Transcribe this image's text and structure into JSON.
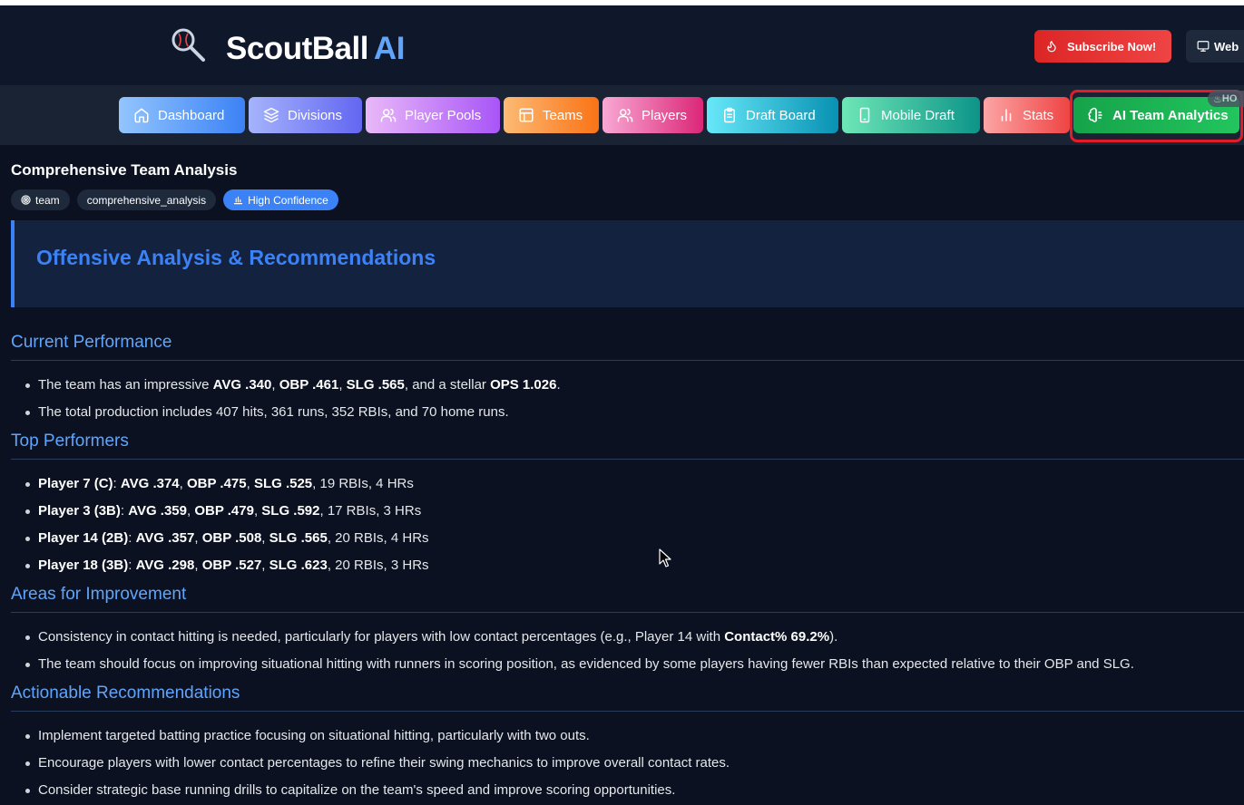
{
  "header": {
    "brand_name": "ScoutBall",
    "brand_ai": "AI",
    "subscribe_label": "Subscribe Now!",
    "web_label": "Web"
  },
  "nav": {
    "items": [
      {
        "label": "Dashboard",
        "icon": "home-icon"
      },
      {
        "label": "Divisions",
        "icon": "layers-icon"
      },
      {
        "label": "Player Pools",
        "icon": "users-icon"
      },
      {
        "label": "Teams",
        "icon": "table-icon"
      },
      {
        "label": "Players",
        "icon": "users-icon"
      },
      {
        "label": "Draft Board",
        "icon": "clipboard-icon"
      },
      {
        "label": "Mobile Draft",
        "icon": "smartphone-icon"
      },
      {
        "label": "Stats",
        "icon": "bar-chart-icon"
      },
      {
        "label": "AI Team Analytics",
        "icon": "brain-icon",
        "active": true
      }
    ],
    "hot_badge": "HO"
  },
  "analysis": {
    "title": "Comprehensive Team Analysis",
    "tags": [
      "team",
      "comprehensive_analysis",
      "High Confidence"
    ]
  },
  "section": {
    "title": "Offensive Analysis & Recommendations"
  },
  "subsections": [
    {
      "heading": "Current Performance",
      "items": [
        [
          {
            "t": "The team has an impressive "
          },
          {
            "b": "AVG .340"
          },
          {
            "t": ", "
          },
          {
            "b": "OBP .461"
          },
          {
            "t": ", "
          },
          {
            "b": "SLG .565"
          },
          {
            "t": ", and a stellar "
          },
          {
            "b": "OPS 1.026"
          },
          {
            "t": "."
          }
        ],
        [
          {
            "t": "The total production includes 407 hits, 361 runs, 352 RBIs, and 70 home runs."
          }
        ]
      ]
    },
    {
      "heading": "Top Performers",
      "items": [
        [
          {
            "b": "Player 7 (C)"
          },
          {
            "t": ": "
          },
          {
            "b": "AVG .374"
          },
          {
            "t": ", "
          },
          {
            "b": "OBP .475"
          },
          {
            "t": ", "
          },
          {
            "b": "SLG .525"
          },
          {
            "t": ", 19 RBIs, 4 HRs"
          }
        ],
        [
          {
            "b": "Player 3 (3B)"
          },
          {
            "t": ": "
          },
          {
            "b": "AVG .359"
          },
          {
            "t": ", "
          },
          {
            "b": "OBP .479"
          },
          {
            "t": ", "
          },
          {
            "b": "SLG .592"
          },
          {
            "t": ", 17 RBIs, 3 HRs"
          }
        ],
        [
          {
            "b": "Player 14 (2B)"
          },
          {
            "t": ": "
          },
          {
            "b": "AVG .357"
          },
          {
            "t": ", "
          },
          {
            "b": "OBP .508"
          },
          {
            "t": ", "
          },
          {
            "b": "SLG .565"
          },
          {
            "t": ", 20 RBIs, 4 HRs"
          }
        ],
        [
          {
            "b": "Player 18 (3B)"
          },
          {
            "t": ": "
          },
          {
            "b": "AVG .298"
          },
          {
            "t": ", "
          },
          {
            "b": "OBP .527"
          },
          {
            "t": ", "
          },
          {
            "b": "SLG .623"
          },
          {
            "t": ", 20 RBIs, 3 HRs"
          }
        ]
      ]
    },
    {
      "heading": "Areas for Improvement",
      "items": [
        [
          {
            "t": "Consistency in contact hitting is needed, particularly for players with low contact percentages (e.g., Player 14 with "
          },
          {
            "b": "Contact% 69.2%"
          },
          {
            "t": ")."
          }
        ],
        [
          {
            "t": "The team should focus on improving situational hitting with runners in scoring position, as evidenced by some players having fewer RBIs than expected relative to their OBP and SLG."
          }
        ]
      ]
    },
    {
      "heading": "Actionable Recommendations",
      "items": [
        [
          {
            "t": "Implement targeted batting practice focusing on situational hitting, particularly with two outs."
          }
        ],
        [
          {
            "t": "Encourage players with lower contact percentages to refine their swing mechanics to improve overall contact rates."
          }
        ],
        [
          {
            "t": "Consider strategic base running drills to capitalize on the team's speed and improve scoring opportunities."
          }
        ]
      ]
    }
  ]
}
